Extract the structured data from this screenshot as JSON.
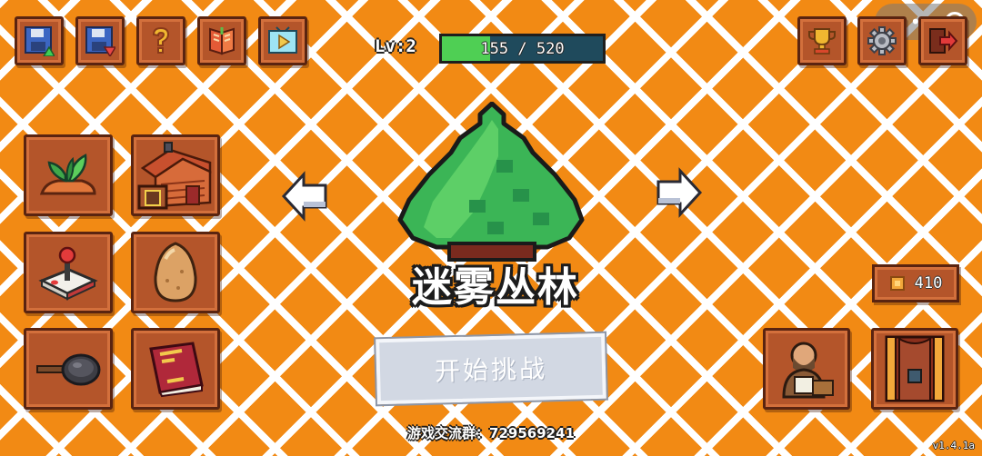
{
  "header": {
    "level_label": "Lv:2",
    "xp_text": "155 / 520",
    "xp_fraction": 0.298
  },
  "top_left_buttons": [
    {
      "name": "save-upload",
      "icon": "save-upload-icon"
    },
    {
      "name": "save-download",
      "icon": "save-download-icon"
    },
    {
      "name": "help",
      "icon": "question-icon"
    },
    {
      "name": "book",
      "icon": "open-book-icon"
    },
    {
      "name": "video",
      "icon": "play-video-icon"
    }
  ],
  "top_right_buttons": [
    {
      "name": "trophy",
      "icon": "trophy-icon"
    },
    {
      "name": "settings",
      "icon": "gear-icon"
    },
    {
      "name": "exit",
      "icon": "exit-icon"
    }
  ],
  "left_menu": [
    {
      "name": "farm",
      "icon": "sprout-icon"
    },
    {
      "name": "house",
      "icon": "house-icon"
    },
    {
      "name": "arcade",
      "icon": "joystick-icon"
    },
    {
      "name": "egg",
      "icon": "egg-icon"
    },
    {
      "name": "cooking",
      "icon": "frying-pan-icon"
    },
    {
      "name": "recipe-book",
      "icon": "red-book-icon"
    }
  ],
  "stage": {
    "name": "迷雾丛林",
    "icon": "pine-bush-icon"
  },
  "start_button_label": "开始挑战",
  "group_text": "游戏交流群：729569241",
  "coins": {
    "value": "410",
    "icon": "coin-icon"
  },
  "bottom_right_buttons": [
    {
      "name": "merchant",
      "icon": "merchant-icon"
    },
    {
      "name": "portal",
      "icon": "portal-door-icon"
    }
  ],
  "version": "v1.4.1a",
  "colors": {
    "background": "#f28a14",
    "grid_lines": "#ffffff",
    "slot": "#b4552a",
    "slot_border": "#5a2410",
    "xp_fill": "#4fcf54",
    "xp_bg": "#1f4a5c",
    "start_button": "#d2d8e3"
  }
}
